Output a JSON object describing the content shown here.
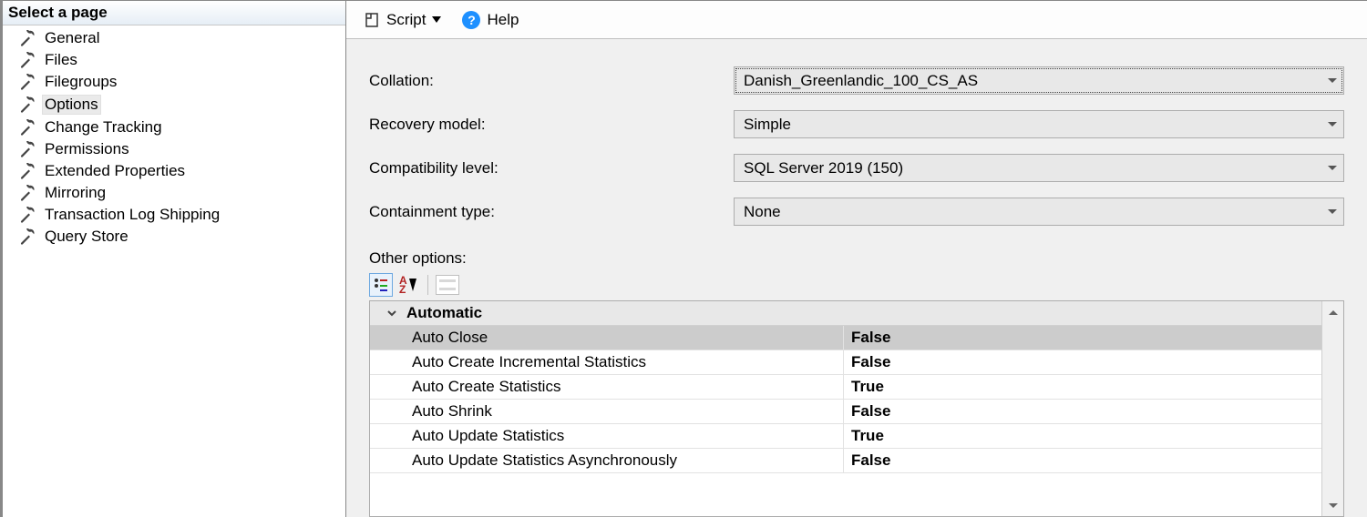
{
  "sidebar": {
    "header": "Select a page",
    "items": [
      "General",
      "Files",
      "Filegroups",
      "Options",
      "Change Tracking",
      "Permissions",
      "Extended Properties",
      "Mirroring",
      "Transaction Log Shipping",
      "Query Store"
    ],
    "selected_index": 3
  },
  "toolbar": {
    "script_label": "Script",
    "help_label": "Help"
  },
  "form": {
    "collation_label": "Collation:",
    "collation_value": "Danish_Greenlandic_100_CS_AS",
    "recovery_label": "Recovery model:",
    "recovery_value": "Simple",
    "compat_label": "Compatibility level:",
    "compat_value": "SQL Server 2019 (150)",
    "containment_label": "Containment type:",
    "containment_value": "None",
    "other_options_label": "Other options:"
  },
  "grid": {
    "category": "Automatic",
    "rows": [
      {
        "name": "Auto Close",
        "value": "False",
        "selected": true
      },
      {
        "name": "Auto Create Incremental Statistics",
        "value": "False"
      },
      {
        "name": "Auto Create Statistics",
        "value": "True"
      },
      {
        "name": "Auto Shrink",
        "value": "False"
      },
      {
        "name": "Auto Update Statistics",
        "value": "True"
      },
      {
        "name": "Auto Update Statistics Asynchronously",
        "value": "False"
      }
    ]
  }
}
